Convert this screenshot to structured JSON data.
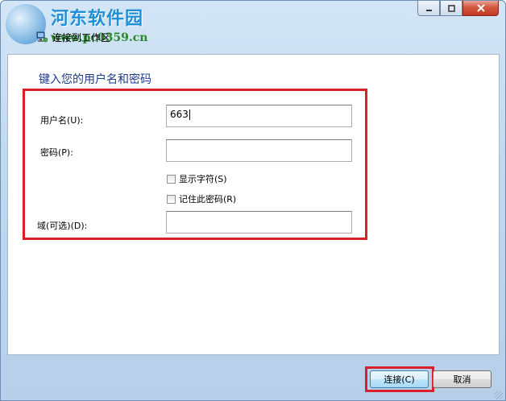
{
  "window": {
    "title": "连接到工作区",
    "icons": {
      "system": "network-icon",
      "minimize": "minimize-icon",
      "maximize": "maximize-icon",
      "close": "close-icon"
    }
  },
  "watermark": {
    "name": "河东软件园",
    "url": "www.pc0359.cn"
  },
  "form": {
    "heading": "键入您的用户名和密码",
    "username_label": "用户名(U):",
    "username_value": "663",
    "password_label": "密码(P):",
    "password_value": "",
    "show_chars_label": "显示字符(S)",
    "remember_label": "记住此密码(R)",
    "domain_label": "域(可选)(D):",
    "domain_value": ""
  },
  "buttons": {
    "connect": "连接(C)",
    "cancel": "取消"
  },
  "colors": {
    "highlight": "#d8202a",
    "heading": "#1e3b8c"
  }
}
